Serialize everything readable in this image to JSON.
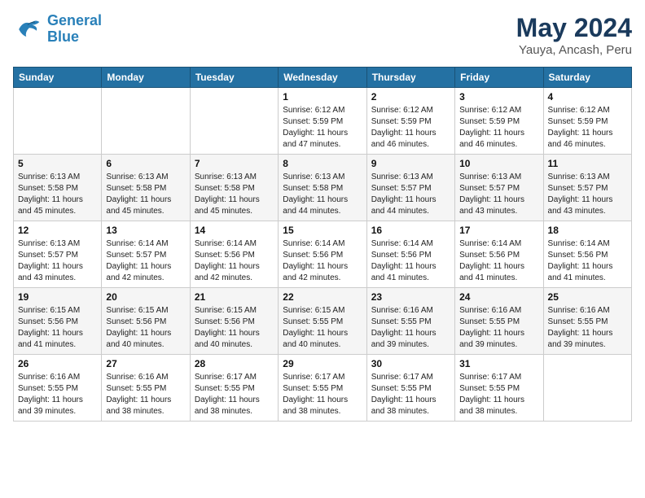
{
  "header": {
    "logo_line1": "General",
    "logo_line2": "Blue",
    "month": "May 2024",
    "location": "Yauya, Ancash, Peru"
  },
  "weekdays": [
    "Sunday",
    "Monday",
    "Tuesday",
    "Wednesday",
    "Thursday",
    "Friday",
    "Saturday"
  ],
  "weeks": [
    [
      {
        "day": "",
        "info": ""
      },
      {
        "day": "",
        "info": ""
      },
      {
        "day": "",
        "info": ""
      },
      {
        "day": "1",
        "info": "Sunrise: 6:12 AM\nSunset: 5:59 PM\nDaylight: 11 hours\nand 47 minutes."
      },
      {
        "day": "2",
        "info": "Sunrise: 6:12 AM\nSunset: 5:59 PM\nDaylight: 11 hours\nand 46 minutes."
      },
      {
        "day": "3",
        "info": "Sunrise: 6:12 AM\nSunset: 5:59 PM\nDaylight: 11 hours\nand 46 minutes."
      },
      {
        "day": "4",
        "info": "Sunrise: 6:12 AM\nSunset: 5:59 PM\nDaylight: 11 hours\nand 46 minutes."
      }
    ],
    [
      {
        "day": "5",
        "info": "Sunrise: 6:13 AM\nSunset: 5:58 PM\nDaylight: 11 hours\nand 45 minutes."
      },
      {
        "day": "6",
        "info": "Sunrise: 6:13 AM\nSunset: 5:58 PM\nDaylight: 11 hours\nand 45 minutes."
      },
      {
        "day": "7",
        "info": "Sunrise: 6:13 AM\nSunset: 5:58 PM\nDaylight: 11 hours\nand 45 minutes."
      },
      {
        "day": "8",
        "info": "Sunrise: 6:13 AM\nSunset: 5:58 PM\nDaylight: 11 hours\nand 44 minutes."
      },
      {
        "day": "9",
        "info": "Sunrise: 6:13 AM\nSunset: 5:57 PM\nDaylight: 11 hours\nand 44 minutes."
      },
      {
        "day": "10",
        "info": "Sunrise: 6:13 AM\nSunset: 5:57 PM\nDaylight: 11 hours\nand 43 minutes."
      },
      {
        "day": "11",
        "info": "Sunrise: 6:13 AM\nSunset: 5:57 PM\nDaylight: 11 hours\nand 43 minutes."
      }
    ],
    [
      {
        "day": "12",
        "info": "Sunrise: 6:13 AM\nSunset: 5:57 PM\nDaylight: 11 hours\nand 43 minutes."
      },
      {
        "day": "13",
        "info": "Sunrise: 6:14 AM\nSunset: 5:57 PM\nDaylight: 11 hours\nand 42 minutes."
      },
      {
        "day": "14",
        "info": "Sunrise: 6:14 AM\nSunset: 5:56 PM\nDaylight: 11 hours\nand 42 minutes."
      },
      {
        "day": "15",
        "info": "Sunrise: 6:14 AM\nSunset: 5:56 PM\nDaylight: 11 hours\nand 42 minutes."
      },
      {
        "day": "16",
        "info": "Sunrise: 6:14 AM\nSunset: 5:56 PM\nDaylight: 11 hours\nand 41 minutes."
      },
      {
        "day": "17",
        "info": "Sunrise: 6:14 AM\nSunset: 5:56 PM\nDaylight: 11 hours\nand 41 minutes."
      },
      {
        "day": "18",
        "info": "Sunrise: 6:14 AM\nSunset: 5:56 PM\nDaylight: 11 hours\nand 41 minutes."
      }
    ],
    [
      {
        "day": "19",
        "info": "Sunrise: 6:15 AM\nSunset: 5:56 PM\nDaylight: 11 hours\nand 41 minutes."
      },
      {
        "day": "20",
        "info": "Sunrise: 6:15 AM\nSunset: 5:56 PM\nDaylight: 11 hours\nand 40 minutes."
      },
      {
        "day": "21",
        "info": "Sunrise: 6:15 AM\nSunset: 5:56 PM\nDaylight: 11 hours\nand 40 minutes."
      },
      {
        "day": "22",
        "info": "Sunrise: 6:15 AM\nSunset: 5:55 PM\nDaylight: 11 hours\nand 40 minutes."
      },
      {
        "day": "23",
        "info": "Sunrise: 6:16 AM\nSunset: 5:55 PM\nDaylight: 11 hours\nand 39 minutes."
      },
      {
        "day": "24",
        "info": "Sunrise: 6:16 AM\nSunset: 5:55 PM\nDaylight: 11 hours\nand 39 minutes."
      },
      {
        "day": "25",
        "info": "Sunrise: 6:16 AM\nSunset: 5:55 PM\nDaylight: 11 hours\nand 39 minutes."
      }
    ],
    [
      {
        "day": "26",
        "info": "Sunrise: 6:16 AM\nSunset: 5:55 PM\nDaylight: 11 hours\nand 39 minutes."
      },
      {
        "day": "27",
        "info": "Sunrise: 6:16 AM\nSunset: 5:55 PM\nDaylight: 11 hours\nand 38 minutes."
      },
      {
        "day": "28",
        "info": "Sunrise: 6:17 AM\nSunset: 5:55 PM\nDaylight: 11 hours\nand 38 minutes."
      },
      {
        "day": "29",
        "info": "Sunrise: 6:17 AM\nSunset: 5:55 PM\nDaylight: 11 hours\nand 38 minutes."
      },
      {
        "day": "30",
        "info": "Sunrise: 6:17 AM\nSunset: 5:55 PM\nDaylight: 11 hours\nand 38 minutes."
      },
      {
        "day": "31",
        "info": "Sunrise: 6:17 AM\nSunset: 5:55 PM\nDaylight: 11 hours\nand 38 minutes."
      },
      {
        "day": "",
        "info": ""
      }
    ]
  ]
}
